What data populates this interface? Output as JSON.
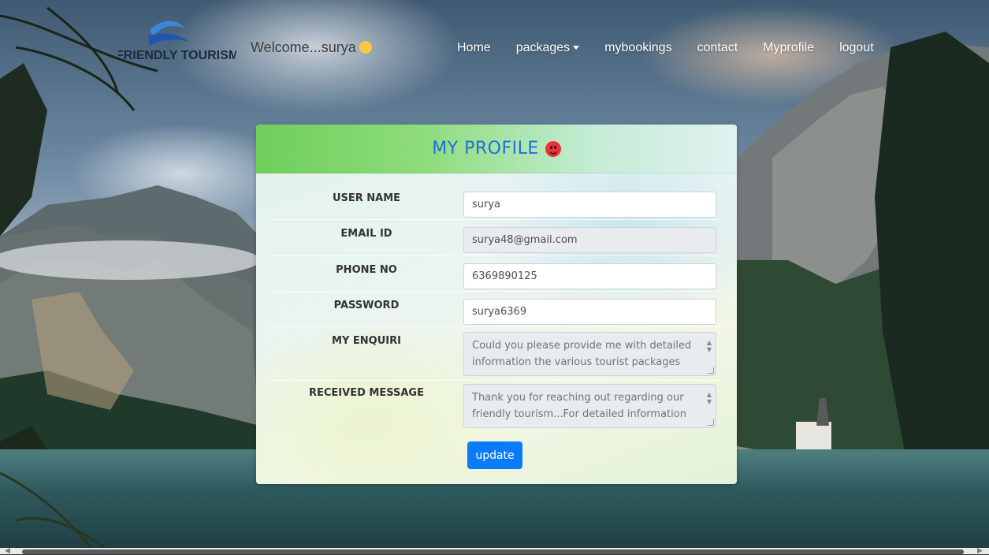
{
  "header": {
    "logo_text": "FRIENDLY TOURISM",
    "welcome": "Welcome...surya",
    "nav": [
      "Home",
      "packages",
      "mybookings",
      "contact",
      "Myprofile",
      "logout"
    ]
  },
  "profile": {
    "title": "MY PROFILE",
    "fields": [
      {
        "label": "USER NAME",
        "value": "surya"
      },
      {
        "label": "EMAIL ID",
        "value": "surya48@gmail.com"
      },
      {
        "label": "PHONE NO",
        "value": "6369890125"
      },
      {
        "label": "PASSWORD",
        "value": "surya6369"
      },
      {
        "label": "MY ENQUIRI",
        "value": "Could you please provide me with detailed information the various tourist packages"
      },
      {
        "label": "RECEIVED MESSAGE",
        "value": "Thank you for reaching out regarding our friendly tourism...For detailed information"
      }
    ],
    "update_label": "update"
  },
  "colors": {
    "nav_text": "#ffffff",
    "title": "#1f6fd8",
    "button": "#0a7cf8",
    "header_gradient_start": "#6fcf5a"
  }
}
